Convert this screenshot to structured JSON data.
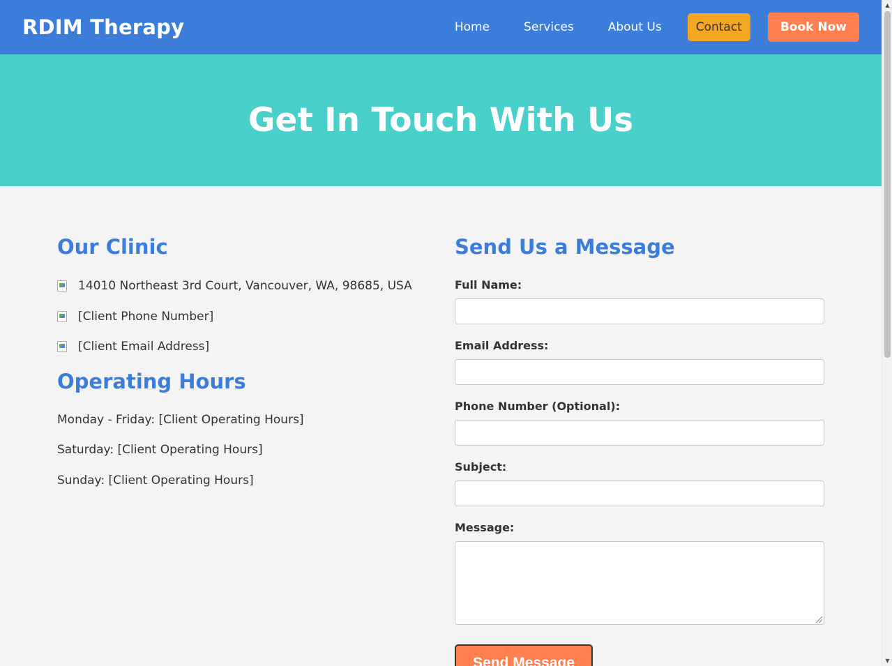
{
  "header": {
    "logo": "RDIM Therapy",
    "nav": {
      "home": "Home",
      "services": "Services",
      "about": "About Us",
      "contact": "Contact",
      "book": "Book Now"
    }
  },
  "hero": {
    "title": "Get In Touch With Us"
  },
  "clinic": {
    "heading": "Our Clinic",
    "items": [
      {
        "icon": "location-icon",
        "text": "14010 Northeast 3rd Court, Vancouver, WA, 98685, USA"
      },
      {
        "icon": "phone-icon",
        "text": "[Client Phone Number]"
      },
      {
        "icon": "email-icon",
        "text": "[Client Email Address]"
      }
    ]
  },
  "hours": {
    "heading": "Operating Hours",
    "items": [
      "Monday - Friday: [Client Operating Hours]",
      "Saturday: [Client Operating Hours]",
      "Sunday: [Client Operating Hours]"
    ]
  },
  "form": {
    "heading": "Send Us a Message",
    "full_name_label": "Full Name:",
    "full_name_value": "",
    "email_label": "Email Address:",
    "email_value": "",
    "phone_label": "Phone Number (Optional):",
    "phone_value": "",
    "subject_label": "Subject:",
    "subject_value": "",
    "message_label": "Message:",
    "message_value": "",
    "submit_label": "Send Message"
  },
  "colors": {
    "header_bg": "#3b7dd8",
    "hero_bg": "#4ad0cb",
    "contact_bg": "#f5a623",
    "book_bg": "#ff7f50",
    "heading": "#3b7dd8"
  }
}
